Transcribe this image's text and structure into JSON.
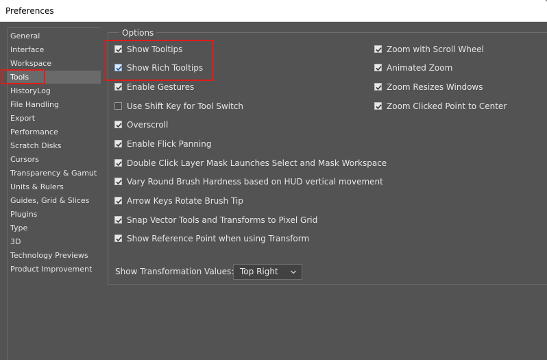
{
  "window": {
    "title": "Preferences"
  },
  "sidebar": {
    "items": [
      {
        "label": "General"
      },
      {
        "label": "Interface"
      },
      {
        "label": "Workspace"
      },
      {
        "label": "Tools"
      },
      {
        "label": "HistoryLog"
      },
      {
        "label": "File Handling"
      },
      {
        "label": "Export"
      },
      {
        "label": "Performance"
      },
      {
        "label": "Scratch Disks"
      },
      {
        "label": "Cursors"
      },
      {
        "label": "Transparency & Gamut"
      },
      {
        "label": "Units & Rulers"
      },
      {
        "label": "Guides, Grid & Slices"
      },
      {
        "label": "Plugins"
      },
      {
        "label": "Type"
      },
      {
        "label": "3D"
      },
      {
        "label": "Technology Previews"
      },
      {
        "label": "Product Improvement"
      }
    ],
    "selected": "Tools"
  },
  "options": {
    "legend": "Options",
    "left": [
      {
        "label": "Show Tooltips",
        "checked": true
      },
      {
        "label": "Show Rich Tooltips",
        "checked": true
      },
      {
        "label": "Enable Gestures",
        "checked": true
      },
      {
        "label": "Use Shift Key for Tool Switch",
        "checked": false
      },
      {
        "label": "Overscroll",
        "checked": true
      },
      {
        "label": "Enable Flick Panning",
        "checked": true
      },
      {
        "label": "Double Click Layer Mask Launches Select and Mask Workspace",
        "checked": true
      },
      {
        "label": "Vary Round Brush Hardness based on HUD vertical movement",
        "checked": true
      },
      {
        "label": "Arrow Keys Rotate Brush Tip",
        "checked": true
      },
      {
        "label": "Snap Vector Tools and Transforms to Pixel Grid",
        "checked": true
      },
      {
        "label": "Show Reference Point when using Transform",
        "checked": true
      }
    ],
    "right": [
      {
        "label": "Zoom with Scroll Wheel",
        "checked": true
      },
      {
        "label": "Animated Zoom",
        "checked": true
      },
      {
        "label": "Zoom Resizes Windows",
        "checked": true
      },
      {
        "label": "Zoom Clicked Point to Center",
        "checked": true
      }
    ]
  },
  "transformation": {
    "label": "Show Transformation Values:",
    "value": "Top Right"
  },
  "colors": {
    "background": "#535353",
    "highlight": "#e01d1d",
    "selected": "#6a6a6a"
  }
}
